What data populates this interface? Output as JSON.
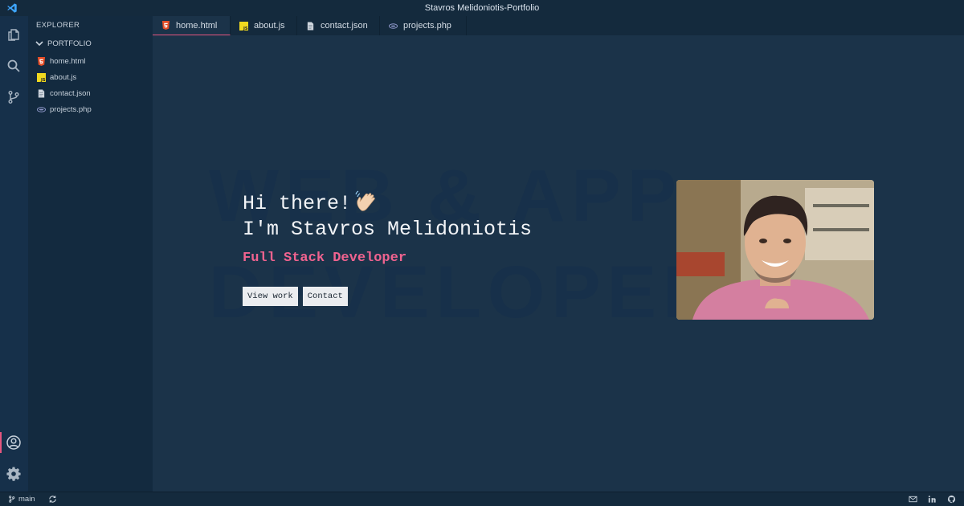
{
  "window": {
    "title": "Stavros Melidoniotis-Portfolio"
  },
  "sidebar": {
    "explorer_title": "EXPLORER",
    "folder": "PORTFOLIO",
    "files": [
      {
        "name": "home.html",
        "icon": "html5-icon"
      },
      {
        "name": "about.js",
        "icon": "js-icon"
      },
      {
        "name": "contact.json",
        "icon": "json-icon"
      },
      {
        "name": "projects.php",
        "icon": "php-icon"
      }
    ]
  },
  "tabs": [
    {
      "label": "home.html",
      "icon": "html5-icon",
      "active": true
    },
    {
      "label": "about.js",
      "icon": "js-icon",
      "active": false
    },
    {
      "label": "contact.json",
      "icon": "json-icon",
      "active": false
    },
    {
      "label": "projects.php",
      "icon": "php-icon",
      "active": false
    }
  ],
  "hero": {
    "line1": "Hi there!",
    "line2": "I'm Stavros Melidoniotis",
    "role": "Full Stack Developer",
    "view_work": "View work",
    "contact": "Contact",
    "bg_line1": "WEB & APP",
    "bg_line2": "DEVELOPER"
  },
  "statusbar": {
    "branch": "main"
  },
  "colors": {
    "accent": "#e5567f",
    "role": "#f0638f",
    "background": "#1b3349",
    "sidebar": "#132a3f"
  }
}
